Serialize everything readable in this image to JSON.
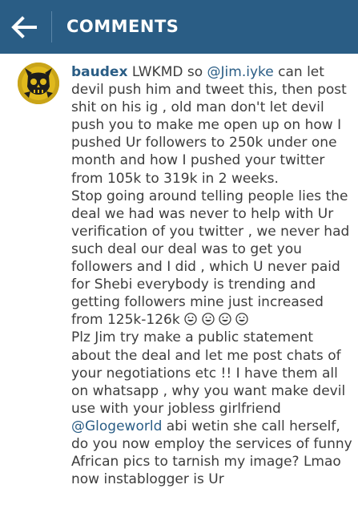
{
  "header": {
    "title": "COMMENTS",
    "back_icon": "back-arrow-icon",
    "background_color": "#2a5d85"
  },
  "comment": {
    "username": "baudex",
    "mention_jim": "@Jim.iyke",
    "mention_gloge": "@Glogeworld",
    "text_1": " LWKMD so ",
    "text_2": " can let devil push him and tweet this, then post shit on his ig , old man don't let devil push you to make me open up on how I pushed Ur followers to 250k under one month and how I pushed your twitter from 105k to 319k in 2 weeks.\nStop going around telling people lies the deal we had was never to help with Ur verification of you twitter , we never had such deal our deal was to get you followers and I did , which U never paid for Shebi everybody is trending and getting followers mine just increased from 125k-126k ",
    "text_3": "\nPlz Jim try make a public statement about the deal and let me post chats of your negotiations etc !! I have them all on whatsapp , why you want make devil use with your jobless girlfriend ",
    "text_4": " abi wetin she call herself, do you now employ the services of funny African pics to tarnish my image? Lmao now instablogger is Ur",
    "emoji_name": "grinning-face-icon",
    "emoji_count": 4,
    "username_color": "#2a5d85",
    "text_color": "#3d3d3d"
  }
}
